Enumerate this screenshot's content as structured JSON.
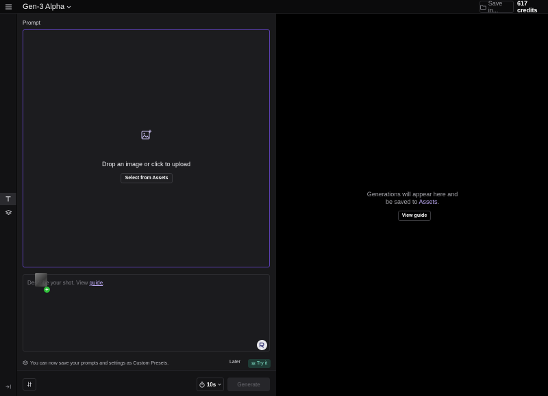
{
  "topbar": {
    "model_label": "Gen-3 Alpha",
    "save_label": "Save in...",
    "credits_label": "617 credits"
  },
  "rail": {
    "items": [
      {
        "icon": "text-icon",
        "active": true
      },
      {
        "icon": "layers-icon",
        "active": false
      }
    ],
    "collapse_icon": "collapse-icon"
  },
  "prompt": {
    "label": "Prompt",
    "dropzone": {
      "icon": "image-add-icon",
      "text": "Drop an image or click to upload",
      "button_label": "Select from Assets"
    },
    "textarea": {
      "placeholder_before": "Describe your shot. View ",
      "placeholder_link": "guide",
      "placeholder_after": "."
    }
  },
  "presets_notice": {
    "text": "You can now save your prompts and settings as Custom Presets.",
    "later_label": "Later",
    "try_label": "Try it"
  },
  "bottom_bar": {
    "duration_label": "10s",
    "generate_label": "Generate"
  },
  "output": {
    "empty_line1": "Generations will appear here and",
    "empty_line2_before": "be saved to ",
    "empty_line2_link": "Assets",
    "empty_line2_after": ".",
    "guide_button_label": "View guide"
  },
  "colors": {
    "accent": "#5b3fb0",
    "link": "#b9a7f0",
    "try_bg": "#1f3b35",
    "try_fg": "#7fe0c7",
    "plus_badge": "#2fbf3a"
  }
}
